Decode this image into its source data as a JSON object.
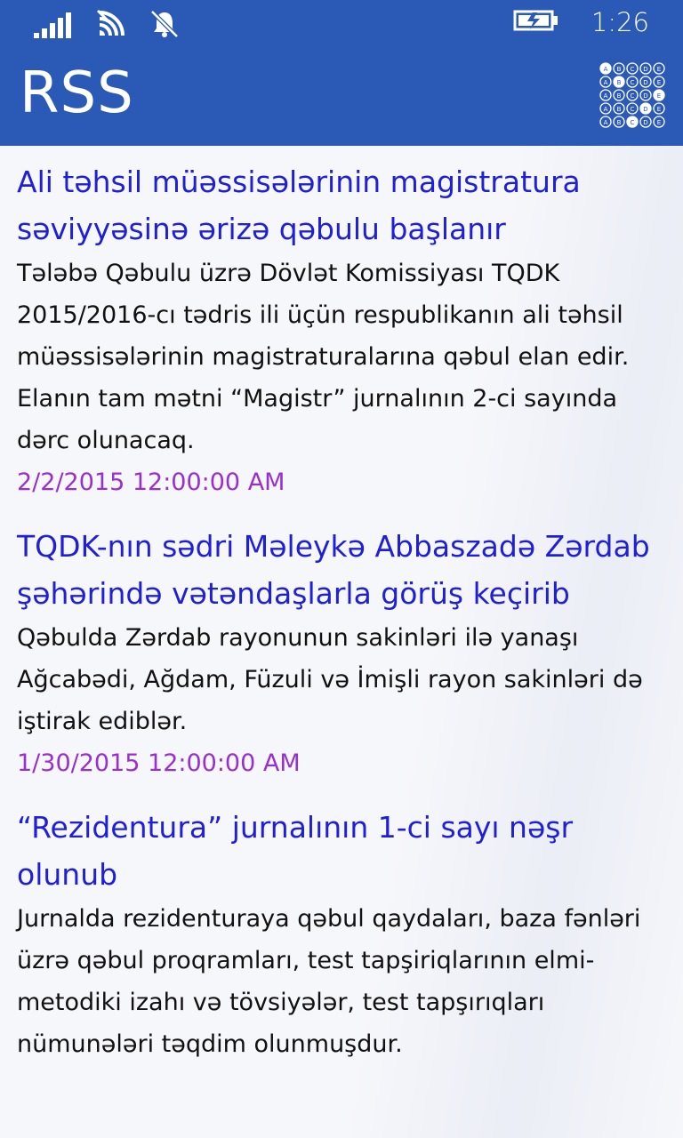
{
  "status_bar": {
    "time": "1:26",
    "icons": [
      "signal-icon",
      "wifi-icon",
      "silent-bell-icon",
      "battery-charging-icon"
    ]
  },
  "header": {
    "title": "RSS",
    "logo_icon": "answer-sheet-logo-icon"
  },
  "feed": {
    "items": [
      {
        "title": "Ali təhsil müəssisələrinin magistratura səviyyəsinə ərizə qəbulu başlanır",
        "description": "Tələbə Qəbulu üzrə Dövlət Komissiyası  TQDK 2015/2016-cı tədris ili üçün respublikanın ali təhsil müəssisələrinin magistraturalarına qəbul elan edir. Elanın tam mətni “Magistr” jurnalının 2-ci sayında dərc olunacaq.",
        "date": "2/2/2015 12:00:00 AM"
      },
      {
        "title": "TQDK-nın sədri Məleykə Abbaszadə Zərdab şəhərində vətəndaşlarla görüş keçirib",
        "description": "Qəbulda Zərdab rayonunun sakinləri ilə yanaşı Ağcabədi, Ağdam, Füzuli və İmişli rayon sakinləri də iştirak ediblər.",
        "date": "1/30/2015 12:00:00 AM"
      },
      {
        "title": "“Rezidentura” jurnalının 1-ci sayı nəşr olunub",
        "description": "Jurnalda rezidenturaya qəbul qaydaları, baza fənləri üzrə qəbul proqramları, test tapşiriqlarının elmi-metodiki izahı və tövsiyələr, test tapşırıqları nümunələri təqdim olunmuşdur.",
        "date": ""
      }
    ]
  },
  "colors": {
    "accent": "#2a5ab6",
    "title_link": "#1f1fd6",
    "date": "#9a2fcf"
  }
}
